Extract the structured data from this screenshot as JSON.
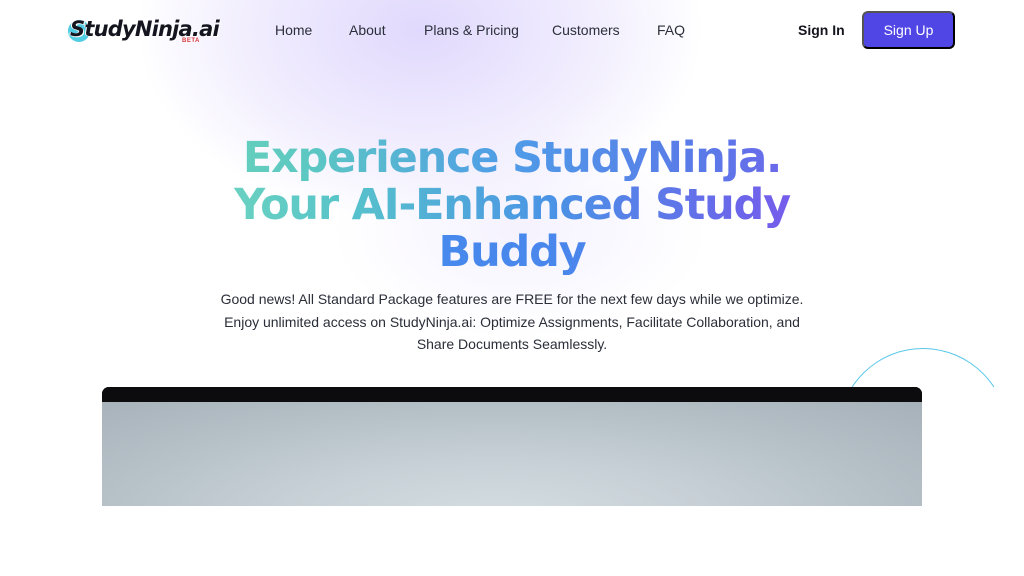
{
  "brand": {
    "name": "StudyNinja.ai",
    "badge": "BETA",
    "accent": "#4f46e5"
  },
  "nav": {
    "items": [
      {
        "label": "Home"
      },
      {
        "label": "About"
      },
      {
        "label": "Plans & Pricing"
      },
      {
        "label": "Customers"
      },
      {
        "label": "FAQ"
      }
    ],
    "sign_in": "Sign In",
    "sign_up": "Sign Up"
  },
  "hero": {
    "title_line1": "Experience StudyNinja.",
    "title_line2": "Your AI-Enhanced Study",
    "title_line3": "Buddy",
    "subtitle": "Good news! All Standard Package features are FREE for the next few days while we optimize. Enjoy unlimited access on StudyNinja.ai: Optimize Assignments, Facilitate Collaboration, and Share Documents Seamlessly."
  },
  "colors": {
    "gradient_start": "#72dcb0",
    "gradient_mid": "#4f9be8",
    "gradient_end": "#8b4ef0",
    "sign_up_bg": "#4f46e5"
  }
}
